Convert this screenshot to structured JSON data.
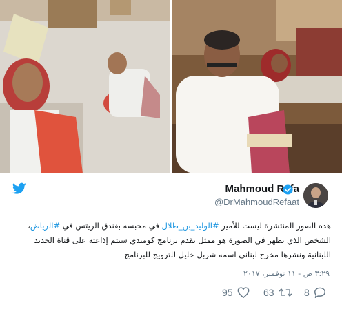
{
  "tweet": {
    "author_name": "Mahmoud Refa",
    "handle": "@DrMahmoudRefaat",
    "text_parts": [
      {
        "t": "هذه الصور المنتشرة ليست للأمير ",
        "tag": false
      },
      {
        "t": "#الوليد_بن_طلال",
        "tag": true
      },
      {
        "t": " في محبسه بفندق الريتس في ",
        "tag": false
      },
      {
        "t": "#الرياض",
        "tag": true
      },
      {
        "t": "، الشخص الذي يظهر في الصورة هو ممثل يقدم برنامج كوميدي سيتم إذاعته على قناة الجديد اللبنانية ونشرها مخرج لبناني اسمه شربل خليل للترويج للبرنامج",
        "tag": false
      }
    ],
    "timestamp": "٣:٢٩ ص - ١١ نوفمبر، ٢٠١٧",
    "reply_count": "8",
    "retweet_count": "63",
    "like_count": "95"
  },
  "icons": {
    "brand": "twitter-bird-icon",
    "verified": "verified-badge-icon",
    "reply": "reply-bubble-icon",
    "retweet": "retweet-arrows-icon",
    "like": "heart-icon"
  },
  "colors": {
    "brand_blue": "#1da1f2",
    "hashtag_blue": "#1b95e0",
    "muted_gray": "#657786",
    "text_dark": "#14171a"
  }
}
